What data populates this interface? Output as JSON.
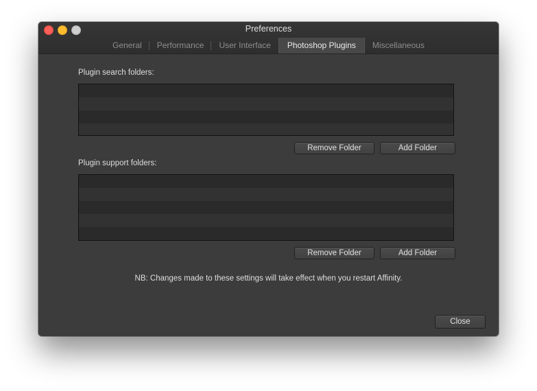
{
  "window": {
    "title": "Preferences"
  },
  "tabs": [
    {
      "label": "General",
      "active": false
    },
    {
      "label": "Performance",
      "active": false
    },
    {
      "label": "User Interface",
      "active": false
    },
    {
      "label": "Photoshop Plugins",
      "active": true
    },
    {
      "label": "Miscellaneous",
      "active": false
    }
  ],
  "search_folders": {
    "label": "Plugin search folders:",
    "items": [],
    "remove_label": "Remove Folder",
    "add_label": "Add Folder"
  },
  "support_folders": {
    "label": "Plugin support folders:",
    "items": [],
    "remove_label": "Remove Folder",
    "add_label": "Add Folder"
  },
  "note": "NB: Changes made to these settings will take effect when you restart Affinity.",
  "close_label": "Close",
  "colors": {
    "window_bg": "#3c3c3c",
    "close_dot": "#fc5f57",
    "minimize_dot": "#fdbc2e",
    "zoom_dot": "#cfcfcf"
  }
}
